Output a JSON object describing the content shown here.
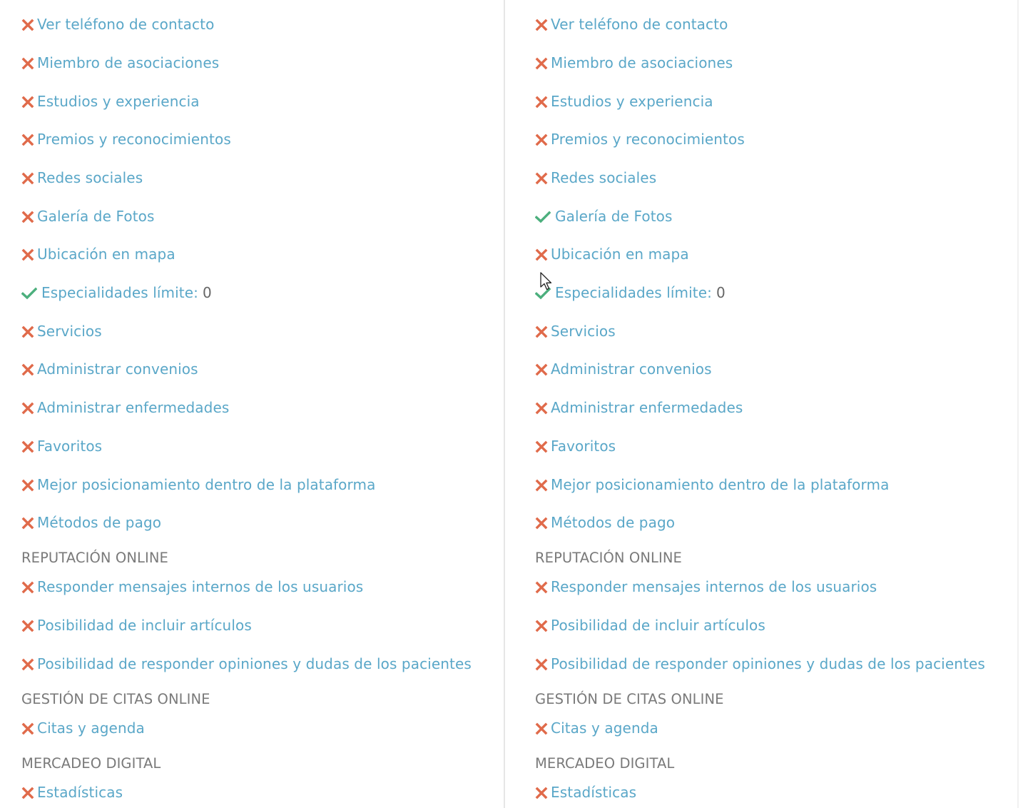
{
  "colors": {
    "link": "#5aa7c8",
    "cross": "#e06a4a",
    "check": "#4caf7d",
    "heading": "#7a7a7a"
  },
  "columns": [
    {
      "rows": [
        {
          "type": "feature",
          "status": "no",
          "icon": "cross-icon",
          "label": "Ver teléfono de contacto"
        },
        {
          "type": "feature",
          "status": "no",
          "icon": "cross-icon",
          "label": "Miembro de asociaciones"
        },
        {
          "type": "feature",
          "status": "no",
          "icon": "cross-icon",
          "label": "Estudios y experiencia"
        },
        {
          "type": "feature",
          "status": "no",
          "icon": "cross-icon",
          "label": "Premios y reconocimientos"
        },
        {
          "type": "feature",
          "status": "no",
          "icon": "cross-icon",
          "label": "Redes sociales"
        },
        {
          "type": "feature",
          "status": "no",
          "icon": "cross-icon",
          "label": "Galería de Fotos"
        },
        {
          "type": "feature",
          "status": "no",
          "icon": "cross-icon",
          "label": "Ubicación en mapa"
        },
        {
          "type": "feature",
          "status": "yes",
          "icon": "check-icon",
          "label": "Especialidades límite:",
          "value": "0"
        },
        {
          "type": "feature",
          "status": "no",
          "icon": "cross-icon",
          "label": "Servicios"
        },
        {
          "type": "feature",
          "status": "no",
          "icon": "cross-icon",
          "label": "Administrar convenios"
        },
        {
          "type": "feature",
          "status": "no",
          "icon": "cross-icon",
          "label": "Administrar enfermedades"
        },
        {
          "type": "feature",
          "status": "no",
          "icon": "cross-icon",
          "label": "Favoritos"
        },
        {
          "type": "feature",
          "status": "no",
          "icon": "cross-icon",
          "label": "Mejor posicionamiento dentro de la plataforma"
        },
        {
          "type": "feature",
          "status": "no",
          "icon": "cross-icon",
          "label": "Métodos de pago"
        },
        {
          "type": "heading",
          "label": "REPUTACIÓN ONLINE"
        },
        {
          "type": "feature",
          "status": "no",
          "icon": "cross-icon",
          "label": "Responder mensajes internos de los usuarios"
        },
        {
          "type": "feature",
          "status": "no",
          "icon": "cross-icon",
          "label": "Posibilidad de incluir artículos"
        },
        {
          "type": "feature",
          "status": "no",
          "icon": "cross-icon",
          "label": "Posibilidad de responder opiniones y dudas de los pacientes"
        },
        {
          "type": "heading",
          "label": "GESTIÓN DE CITAS ONLINE"
        },
        {
          "type": "feature",
          "status": "no",
          "icon": "cross-icon",
          "label": "Citas y agenda"
        },
        {
          "type": "heading",
          "label": "MERCADEO DIGITAL"
        },
        {
          "type": "feature",
          "status": "no",
          "icon": "cross-icon",
          "label": "Estadísticas"
        }
      ]
    },
    {
      "rows": [
        {
          "type": "feature",
          "status": "no",
          "icon": "cross-icon",
          "label": "Ver teléfono de contacto"
        },
        {
          "type": "feature",
          "status": "no",
          "icon": "cross-icon",
          "label": "Miembro de asociaciones"
        },
        {
          "type": "feature",
          "status": "no",
          "icon": "cross-icon",
          "label": "Estudios y experiencia"
        },
        {
          "type": "feature",
          "status": "no",
          "icon": "cross-icon",
          "label": "Premios y reconocimientos"
        },
        {
          "type": "feature",
          "status": "no",
          "icon": "cross-icon",
          "label": "Redes sociales"
        },
        {
          "type": "feature",
          "status": "yes",
          "icon": "check-icon",
          "label": "Galería de Fotos"
        },
        {
          "type": "feature",
          "status": "no",
          "icon": "cross-icon",
          "label": "Ubicación en mapa"
        },
        {
          "type": "feature",
          "status": "yes",
          "icon": "check-icon",
          "label": "Especialidades límite:",
          "value": "0"
        },
        {
          "type": "feature",
          "status": "no",
          "icon": "cross-icon",
          "label": "Servicios"
        },
        {
          "type": "feature",
          "status": "no",
          "icon": "cross-icon",
          "label": "Administrar convenios"
        },
        {
          "type": "feature",
          "status": "no",
          "icon": "cross-icon",
          "label": "Administrar enfermedades"
        },
        {
          "type": "feature",
          "status": "no",
          "icon": "cross-icon",
          "label": "Favoritos"
        },
        {
          "type": "feature",
          "status": "no",
          "icon": "cross-icon",
          "label": "Mejor posicionamiento dentro de la plataforma"
        },
        {
          "type": "feature",
          "status": "no",
          "icon": "cross-icon",
          "label": "Métodos de pago"
        },
        {
          "type": "heading",
          "label": "REPUTACIÓN ONLINE"
        },
        {
          "type": "feature",
          "status": "no",
          "icon": "cross-icon",
          "label": "Responder mensajes internos de los usuarios"
        },
        {
          "type": "feature",
          "status": "no",
          "icon": "cross-icon",
          "label": "Posibilidad de incluir artículos"
        },
        {
          "type": "feature",
          "status": "no",
          "icon": "cross-icon",
          "label": "Posibilidad de responder opiniones y dudas de los pacientes"
        },
        {
          "type": "heading",
          "label": "GESTIÓN DE CITAS ONLINE"
        },
        {
          "type": "feature",
          "status": "no",
          "icon": "cross-icon",
          "label": "Citas y agenda"
        },
        {
          "type": "heading",
          "label": "MERCADEO DIGITAL"
        },
        {
          "type": "feature",
          "status": "no",
          "icon": "cross-icon",
          "label": "Estadísticas"
        }
      ]
    }
  ]
}
